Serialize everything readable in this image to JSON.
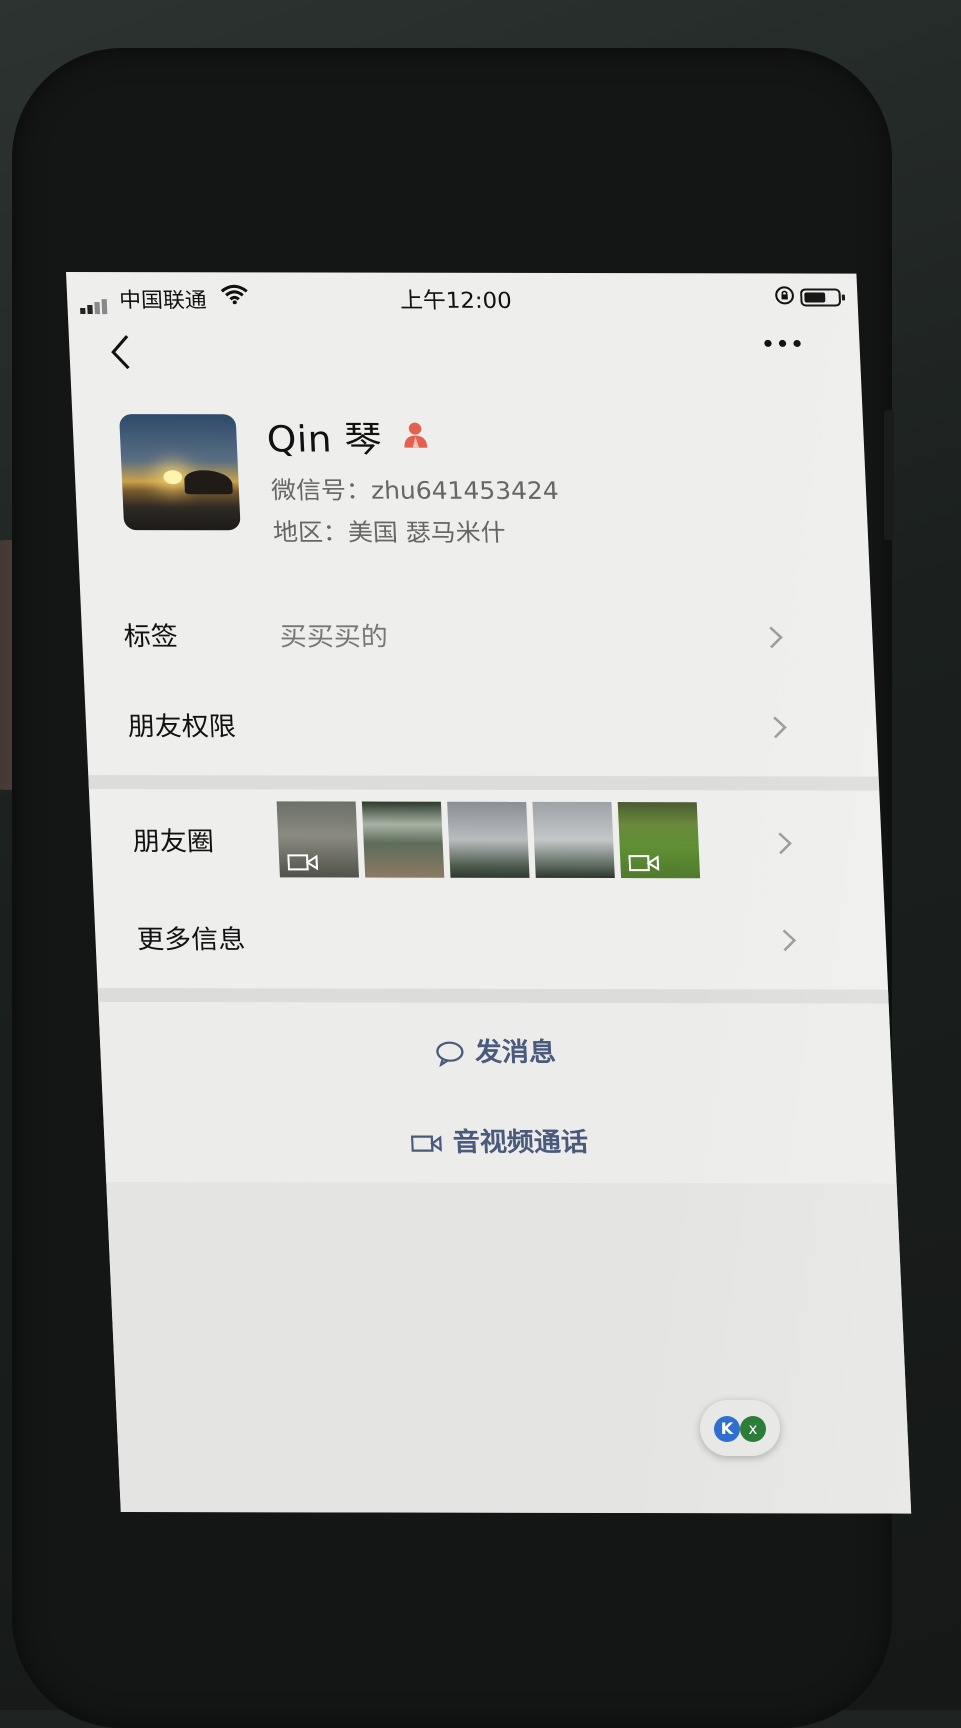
{
  "status_bar": {
    "carrier": "中国联通",
    "time": "上午12:00"
  },
  "profile": {
    "name": "Qin 琴",
    "wechat_id": "微信号：zhu641453424",
    "region": "地区：美国 瑟马米什"
  },
  "rows": {
    "tag_label": "标签",
    "tag_value": "买买买的",
    "permissions_label": "朋友权限",
    "moments_label": "朋友圈",
    "more_info_label": "更多信息"
  },
  "moments_thumbs": [
    {
      "kind": "video"
    },
    {
      "kind": "photo"
    },
    {
      "kind": "photo"
    },
    {
      "kind": "photo"
    },
    {
      "kind": "video"
    }
  ],
  "actions": {
    "send_message": "发消息",
    "av_call": "音视频通话"
  },
  "floating": {
    "left_glyph": "K",
    "right_glyph": "x"
  },
  "icons": {
    "back": "chevron-left-icon",
    "more": "ellipsis-icon",
    "gender": "female-icon",
    "chevron": "chevron-right-icon",
    "message": "chat-bubble-icon",
    "video": "video-camera-icon"
  },
  "colors": {
    "action_text": "#4a5a7c",
    "gender_icon": "#e5604e"
  }
}
